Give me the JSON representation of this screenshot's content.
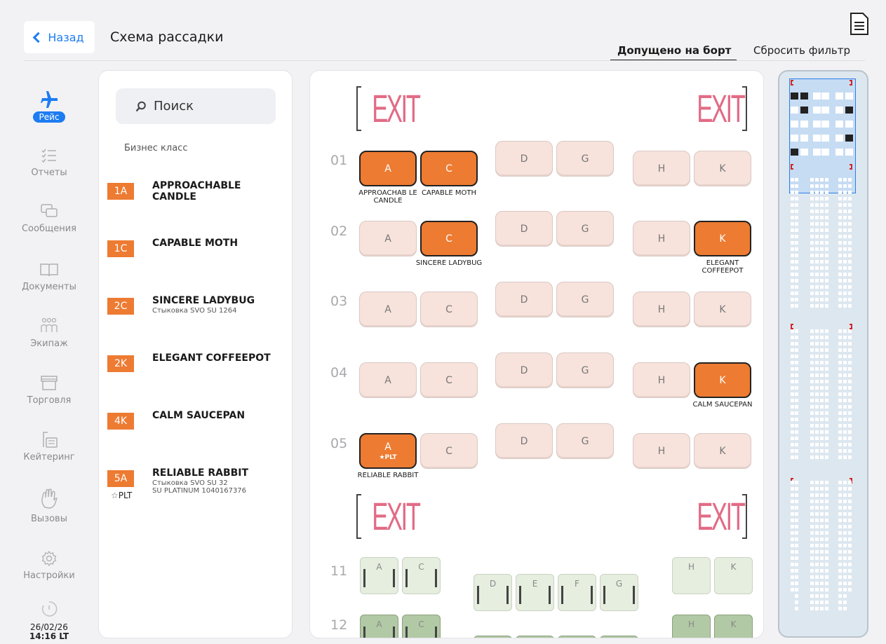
{
  "header": {
    "back_label": "Назад",
    "title": "Схема рассадки",
    "filter_active": "Допущено на борт",
    "filter_reset": "Сбросить фильтр"
  },
  "nav": {
    "flight": "Рейс",
    "reports": "Отчеты",
    "messages": "Сообщения",
    "documents": "Документы",
    "crew": "Экипаж",
    "trade": "Торговля",
    "catering": "Кейтеринг",
    "calls": "Вызовы",
    "settings": "Настройки",
    "date": "26/02/26",
    "time": "14:16 LT"
  },
  "panel": {
    "search_placeholder": "Поиск",
    "class_label": "Бизнес класс",
    "passengers": [
      {
        "seat": "1A",
        "name": "APPROACHABLE CANDLE",
        "sub1": "",
        "sub2": "",
        "plt": ""
      },
      {
        "seat": "1C",
        "name": "CAPABLE MOTH",
        "sub1": "",
        "sub2": "",
        "plt": ""
      },
      {
        "seat": "2C",
        "name": "SINCERE LADYBUG",
        "sub1": "Стыковка SVO SU 1264",
        "sub2": "",
        "plt": ""
      },
      {
        "seat": "2K",
        "name": "ELEGANT COFFEEPOT",
        "sub1": "",
        "sub2": "",
        "plt": ""
      },
      {
        "seat": "4K",
        "name": "CALM SAUCEPAN",
        "sub1": "",
        "sub2": "",
        "plt": ""
      },
      {
        "seat": "5A",
        "name": "RELIABLE RABBIT",
        "sub1": "Стыковка SVO SU 32",
        "sub2": "SU PLATINUM 1040167376",
        "plt": "PLT"
      }
    ]
  },
  "map": {
    "exit_label": "EXIT",
    "rows": [
      "01",
      "02",
      "03",
      "04",
      "05",
      "11",
      "12"
    ],
    "seat_letters": [
      "A",
      "C",
      "D",
      "G",
      "H",
      "K"
    ],
    "economy_letters": [
      "A",
      "C",
      "D",
      "E",
      "F",
      "G",
      "H",
      "K"
    ],
    "occupied": {
      "01A": "APPROACHAB LE CANDLE",
      "01C": "CAPABLE MOTH",
      "02C": "SINCERE LADYBUG",
      "02K": "ELEGANT COFFEEPOT",
      "04K": "CALM SAUCEPAN",
      "05A": "RELIABLE RABBIT"
    },
    "plt_tag": "PLT"
  },
  "colors": {
    "accent": "#1e7cf2",
    "occupied": "#ed7b32",
    "exit": "#e26b86",
    "free": "#f7e3dc",
    "economy": "#e6eee0"
  }
}
